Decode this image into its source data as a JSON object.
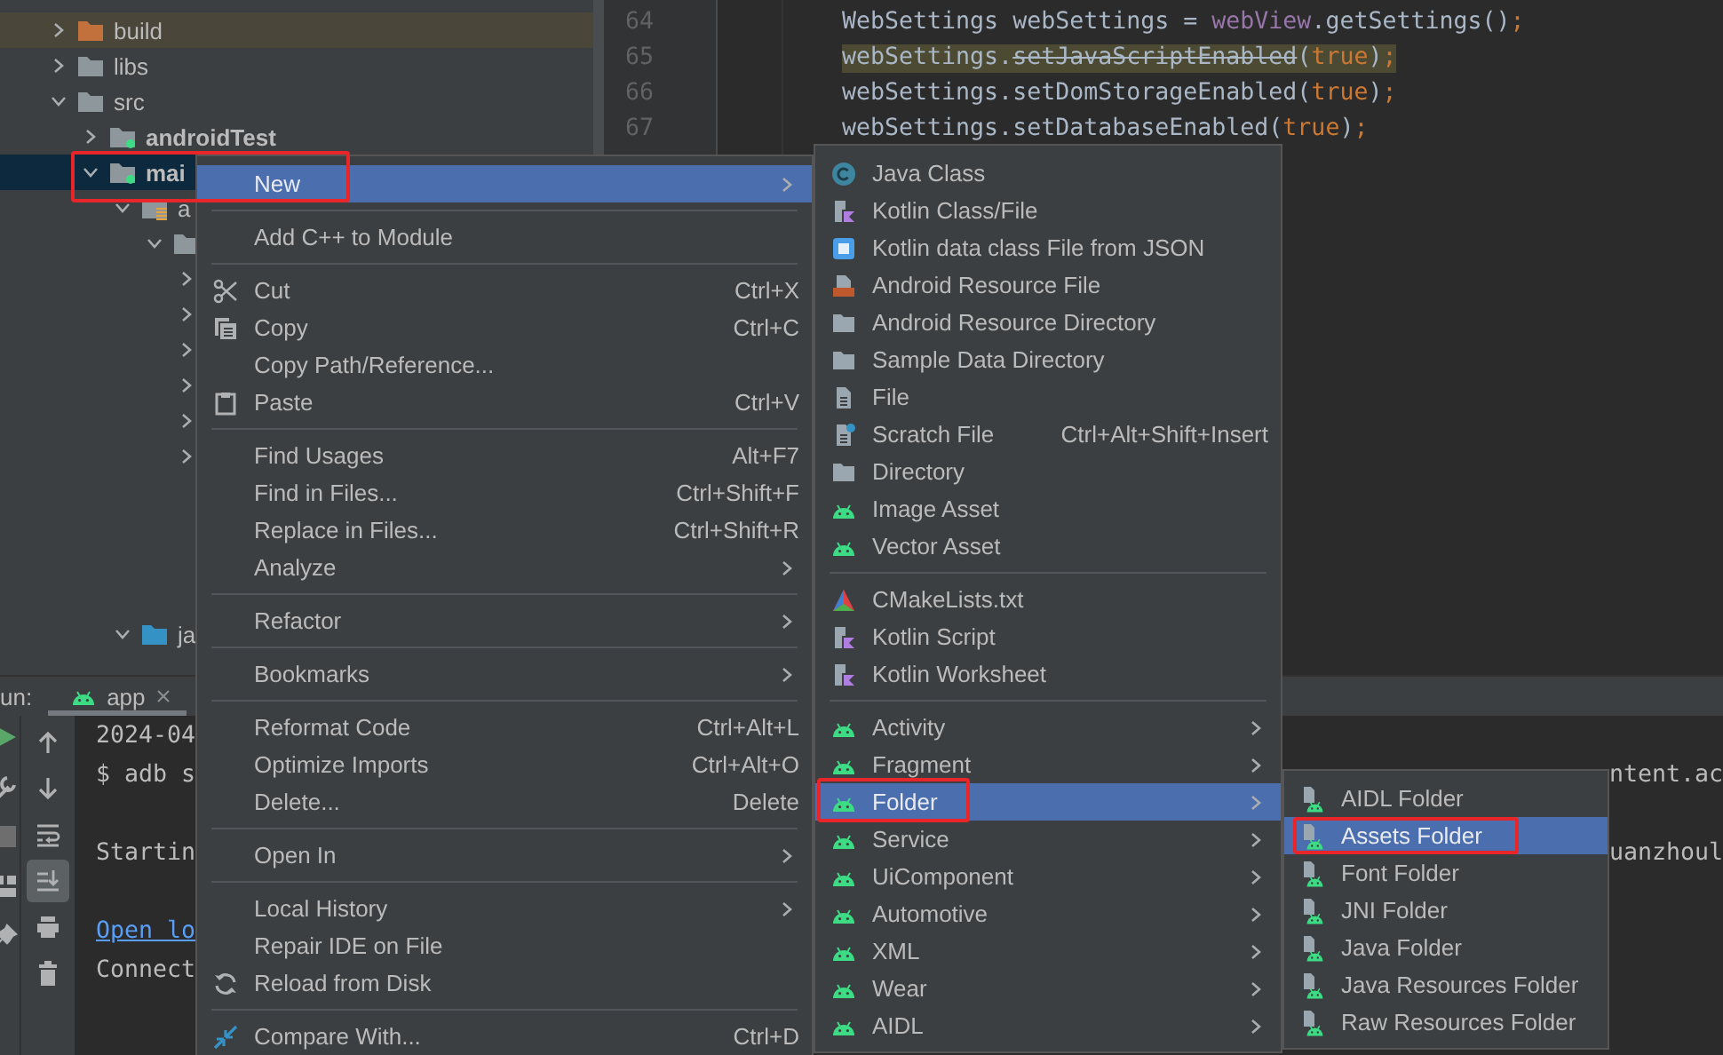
{
  "project_tree": {
    "items": [
      {
        "label": "build",
        "kind": "build",
        "expanded": false,
        "selected": false
      },
      {
        "label": "libs",
        "kind": "folder",
        "expanded": false,
        "selected": false
      },
      {
        "label": "src",
        "kind": "folder",
        "expanded": true,
        "selected": false,
        "children": [
          {
            "label": "androidTest",
            "kind": "module",
            "expanded": false,
            "selected": false
          },
          {
            "label": "mai",
            "kind": "module",
            "expanded": true,
            "selected": true,
            "children": [
              {
                "label": "a",
                "kind": "manifest",
                "expanded": true,
                "selected": false,
                "children": [
                  {
                    "kind": "folder",
                    "expanded": true,
                    "selected": false,
                    "children": [
                      {
                        "expanded": false,
                        "selected": false
                      },
                      {
                        "expanded": false,
                        "selected": false
                      },
                      {
                        "expanded": false,
                        "selected": false
                      },
                      {
                        "expanded": false,
                        "selected": false
                      },
                      {
                        "expanded": false,
                        "selected": false
                      },
                      {
                        "expanded": false,
                        "selected": false
                      }
                    ]
                  }
                ]
              },
              {
                "label": "ja",
                "kind": "source",
                "expanded": true,
                "selected": false
              }
            ]
          }
        ]
      }
    ]
  },
  "editor": {
    "lines": [
      {
        "number": "64",
        "highlighted": false,
        "tokens": [
          {
            "text": "WebSettings webSettings = ",
            "kind": "plain"
          },
          {
            "text": "webView",
            "kind": "field"
          },
          {
            "text": ".getSettings()",
            "kind": "plain"
          },
          {
            "text": ";",
            "kind": "keyword"
          }
        ]
      },
      {
        "number": "65",
        "highlighted": true,
        "tokens": [
          {
            "text": "webSettings.",
            "kind": "plain"
          },
          {
            "text": "setJavaScriptEnabled",
            "kind": "deprecated"
          },
          {
            "text": "(",
            "kind": "plain"
          },
          {
            "text": "true",
            "kind": "keyword"
          },
          {
            "text": ")",
            "kind": "plain"
          },
          {
            "text": ";",
            "kind": "keyword"
          }
        ]
      },
      {
        "number": "66",
        "highlighted": false,
        "tokens": [
          {
            "text": "webSettings.setDomStorageEnabled(",
            "kind": "plain"
          },
          {
            "text": "true",
            "kind": "keyword"
          },
          {
            "text": ")",
            "kind": "plain"
          },
          {
            "text": ";",
            "kind": "keyword"
          }
        ]
      },
      {
        "number": "67",
        "highlighted": false,
        "tokens": [
          {
            "text": "webSettings.setDatabaseEnabled(",
            "kind": "plain"
          },
          {
            "text": "true",
            "kind": "keyword"
          },
          {
            "text": ")",
            "kind": "plain"
          },
          {
            "text": ";",
            "kind": "keyword"
          }
        ]
      }
    ]
  },
  "run_panel": {
    "title": "un:",
    "tabs": [
      {
        "label": "app",
        "selected": true
      }
    ],
    "side_tools": [
      {
        "kind": "run"
      },
      {
        "kind": "wrench"
      },
      {
        "kind": "stop"
      },
      {
        "kind": "layout"
      },
      {
        "kind": "pin"
      }
    ],
    "console_tools": [
      {
        "kind": "up",
        "selected": false
      },
      {
        "kind": "down",
        "selected": false
      },
      {
        "kind": "wrap",
        "selected": false
      },
      {
        "kind": "scroll-end",
        "selected": true
      },
      {
        "kind": "print",
        "selected": false
      },
      {
        "kind": "trash",
        "selected": false
      }
    ],
    "console": [
      {
        "kind": "text",
        "text": "2024-04"
      },
      {
        "kind": "text",
        "text": "$ adb s",
        "tail": "ntent.ac"
      },
      {
        "kind": "blank"
      },
      {
        "kind": "text",
        "text": "Startin",
        "tail": "uanzhoul"
      },
      {
        "kind": "blank"
      },
      {
        "kind": "link",
        "text": "Open lo"
      },
      {
        "kind": "text",
        "text": "Connect"
      }
    ]
  },
  "menus": [
    {
      "sections": [
        {
          "items": [
            {
              "label": "New",
              "kind": "plain",
              "submenu": true,
              "selected": true,
              "boxed": true
            }
          ]
        },
        {
          "items": [
            {
              "label": "Add C++ to Module",
              "kind": "plain",
              "submenu": false,
              "selected": false,
              "boxed": false
            }
          ]
        },
        {
          "items": [
            {
              "label": "Cut",
              "kind": "cut",
              "shortcut": "Ctrl+X",
              "submenu": false,
              "selected": false,
              "boxed": false
            },
            {
              "label": "Copy",
              "kind": "copy",
              "shortcut": "Ctrl+C",
              "submenu": false,
              "selected": false,
              "boxed": false
            },
            {
              "label": "Copy Path/Reference...",
              "kind": "plain",
              "submenu": false,
              "selected": false,
              "boxed": false
            },
            {
              "label": "Paste",
              "kind": "paste",
              "shortcut": "Ctrl+V",
              "submenu": false,
              "selected": false,
              "boxed": false
            }
          ]
        },
        {
          "items": [
            {
              "label": "Find Usages",
              "kind": "plain",
              "shortcut": "Alt+F7",
              "submenu": false,
              "selected": false,
              "boxed": false
            },
            {
              "label": "Find in Files...",
              "kind": "plain",
              "shortcut": "Ctrl+Shift+F",
              "submenu": false,
              "selected": false,
              "boxed": false
            },
            {
              "label": "Replace in Files...",
              "kind": "plain",
              "shortcut": "Ctrl+Shift+R",
              "submenu": false,
              "selected": false,
              "boxed": false
            },
            {
              "label": "Analyze",
              "kind": "plain",
              "submenu": true,
              "selected": false,
              "boxed": false
            }
          ]
        },
        {
          "items": [
            {
              "label": "Refactor",
              "kind": "plain",
              "submenu": true,
              "selected": false,
              "boxed": false
            }
          ]
        },
        {
          "items": [
            {
              "label": "Bookmarks",
              "kind": "plain",
              "submenu": true,
              "selected": false,
              "boxed": false
            }
          ]
        },
        {
          "items": [
            {
              "label": "Reformat Code",
              "kind": "plain",
              "shortcut": "Ctrl+Alt+L",
              "submenu": false,
              "selected": false,
              "boxed": false
            },
            {
              "label": "Optimize Imports",
              "kind": "plain",
              "shortcut": "Ctrl+Alt+O",
              "submenu": false,
              "selected": false,
              "boxed": false
            },
            {
              "label": "Delete...",
              "kind": "plain",
              "shortcut": "Delete",
              "submenu": false,
              "selected": false,
              "boxed": false
            }
          ]
        },
        {
          "items": [
            {
              "label": "Open In",
              "kind": "plain",
              "submenu": true,
              "selected": false,
              "boxed": false
            }
          ]
        },
        {
          "items": [
            {
              "label": "Local History",
              "kind": "plain",
              "submenu": true,
              "selected": false,
              "boxed": false
            },
            {
              "label": "Repair IDE on File",
              "kind": "plain",
              "submenu": false,
              "selected": false,
              "boxed": false
            },
            {
              "label": "Reload from Disk",
              "kind": "reload",
              "submenu": false,
              "selected": false,
              "boxed": false
            }
          ]
        },
        {
          "items": [
            {
              "label": "Compare With...",
              "kind": "compare",
              "shortcut": "Ctrl+D",
              "submenu": false,
              "selected": false,
              "boxed": false
            }
          ]
        }
      ]
    },
    {
      "sections": [
        {
          "items": [
            {
              "label": "Java Class",
              "kind": "class",
              "submenu": false,
              "selected": false,
              "boxed": false
            },
            {
              "label": "Kotlin Class/File",
              "kind": "kotlin",
              "submenu": false,
              "selected": false,
              "boxed": false
            },
            {
              "label": "Kotlin data class File from JSON",
              "kind": "json",
              "submenu": false,
              "selected": false,
              "boxed": false
            },
            {
              "label": "Android Resource File",
              "kind": "resfile",
              "submenu": false,
              "selected": false,
              "boxed": false
            },
            {
              "label": "Android Resource Directory",
              "kind": "dir",
              "submenu": false,
              "selected": false,
              "boxed": false
            },
            {
              "label": "Sample Data Directory",
              "kind": "dir",
              "submenu": false,
              "selected": false,
              "boxed": false
            },
            {
              "label": "File",
              "kind": "file",
              "submenu": false,
              "selected": false,
              "boxed": false
            },
            {
              "label": "Scratch File",
              "kind": "scratch",
              "shortcut": "Ctrl+Alt+Shift+Insert",
              "submenu": false,
              "selected": false,
              "boxed": false
            },
            {
              "label": "Directory",
              "kind": "dir",
              "submenu": false,
              "selected": false,
              "boxed": false
            },
            {
              "label": "Image Asset",
              "kind": "android",
              "submenu": false,
              "selected": false,
              "boxed": false
            },
            {
              "label": "Vector Asset",
              "kind": "android",
              "submenu": false,
              "selected": false,
              "boxed": false
            }
          ]
        },
        {
          "items": [
            {
              "label": "CMakeLists.txt",
              "kind": "cmake",
              "submenu": false,
              "selected": false,
              "boxed": false
            },
            {
              "label": "Kotlin Script",
              "kind": "kotlin",
              "submenu": false,
              "selected": false,
              "boxed": false
            },
            {
              "label": "Kotlin Worksheet",
              "kind": "kotlin",
              "submenu": false,
              "selected": false,
              "boxed": false
            }
          ]
        },
        {
          "items": [
            {
              "label": "Activity",
              "kind": "android",
              "submenu": true,
              "selected": false,
              "boxed": false
            },
            {
              "label": "Fragment",
              "kind": "android",
              "submenu": true,
              "selected": false,
              "boxed": false
            },
            {
              "label": "Folder",
              "kind": "android",
              "submenu": true,
              "selected": true,
              "boxed": true
            },
            {
              "label": "Service",
              "kind": "android",
              "submenu": true,
              "selected": false,
              "boxed": false
            },
            {
              "label": "UiComponent",
              "kind": "android",
              "submenu": true,
              "selected": false,
              "boxed": false
            },
            {
              "label": "Automotive",
              "kind": "android",
              "submenu": true,
              "selected": false,
              "boxed": false
            },
            {
              "label": "XML",
              "kind": "android",
              "submenu": true,
              "selected": false,
              "boxed": false
            },
            {
              "label": "Wear",
              "kind": "android",
              "submenu": true,
              "selected": false,
              "boxed": false
            },
            {
              "label": "AIDL",
              "kind": "android",
              "submenu": true,
              "selected": false,
              "boxed": false
            }
          ]
        }
      ]
    },
    {
      "sections": [
        {
          "items": [
            {
              "label": "AIDL Folder",
              "kind": "andfile",
              "submenu": false,
              "selected": false,
              "boxed": false
            },
            {
              "label": "Assets Folder",
              "kind": "andfile",
              "submenu": false,
              "selected": true,
              "boxed": true
            },
            {
              "label": "Font Folder",
              "kind": "andfile",
              "submenu": false,
              "selected": false,
              "boxed": false
            },
            {
              "label": "JNI Folder",
              "kind": "andfile",
              "submenu": false,
              "selected": false,
              "boxed": false
            },
            {
              "label": "Java Folder",
              "kind": "andfile",
              "submenu": false,
              "selected": false,
              "boxed": false
            },
            {
              "label": "Java Resources Folder",
              "kind": "andfile",
              "submenu": false,
              "selected": false,
              "boxed": false
            },
            {
              "label": "Raw Resources Folder",
              "kind": "andfile",
              "submenu": false,
              "selected": false,
              "boxed": false
            }
          ]
        }
      ]
    }
  ]
}
